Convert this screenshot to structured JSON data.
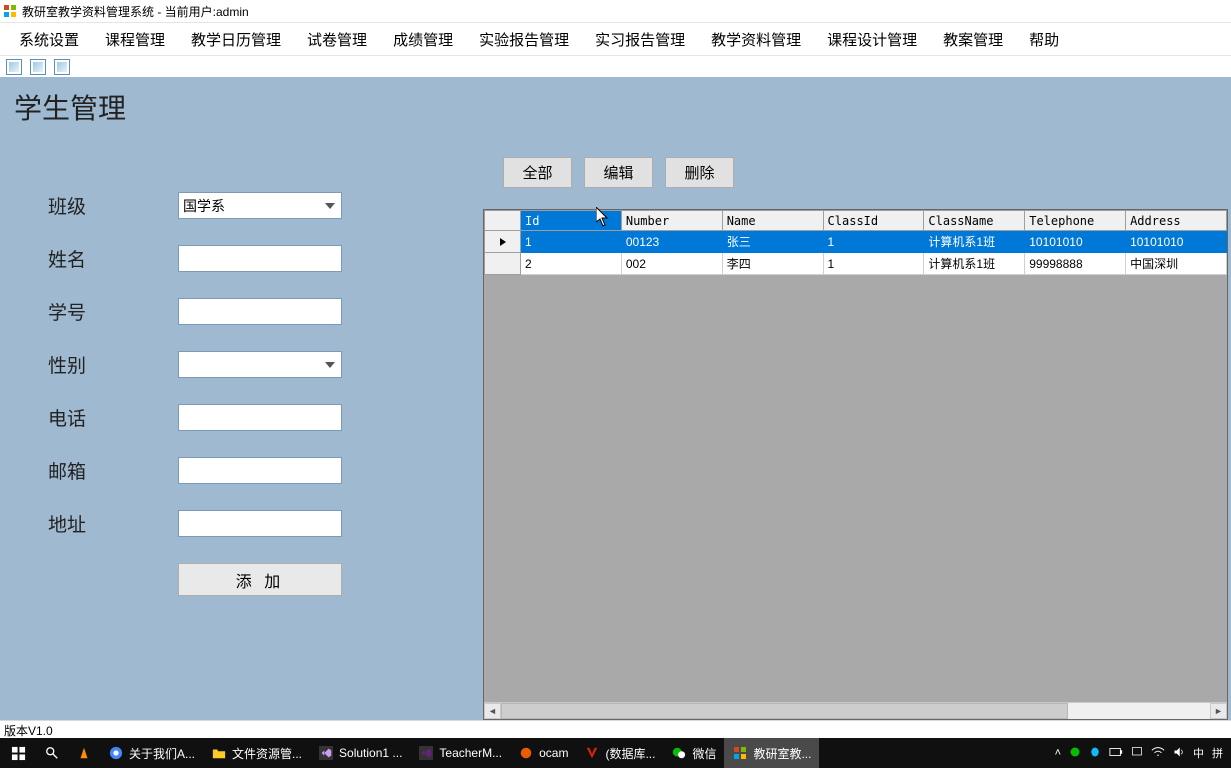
{
  "window": {
    "title": "教研室教学资料管理系统 - 当前用户:admin"
  },
  "menu": {
    "items": [
      "系统设置",
      "课程管理",
      "教学日历管理",
      "试卷管理",
      "成绩管理",
      "实验报告管理",
      "实习报告管理",
      "教学资料管理",
      "课程设计管理",
      "教案管理",
      "帮助"
    ]
  },
  "page_title": "学生管理",
  "form": {
    "labels": {
      "class": "班级",
      "name": "姓名",
      "sno": "学号",
      "gender": "性别",
      "phone": "电话",
      "email": "邮箱",
      "address": "地址"
    },
    "class_value": "国学系",
    "name_value": "",
    "sno_value": "",
    "gender_value": "",
    "phone_value": "",
    "email_value": "",
    "address_value": "",
    "add_button": "添 加"
  },
  "toolbar": {
    "all": "全部",
    "edit": "编辑",
    "delete": "删除"
  },
  "grid": {
    "headers": [
      "Id",
      "Number",
      "Name",
      "ClassId",
      "ClassName",
      "Telephone",
      "Address"
    ],
    "rows": [
      {
        "Id": "1",
        "Number": "00123",
        "Name": "张三",
        "ClassId": "1",
        "ClassName": "计算机系1班",
        "Telephone": "10101010",
        "Address": "10101010"
      },
      {
        "Id": "2",
        "Number": "002",
        "Name": "李四",
        "ClassId": "1",
        "ClassName": "计算机系1班",
        "Telephone": "99998888",
        "Address": "中国深圳"
      }
    ],
    "selected_row": 0,
    "selected_col": 0
  },
  "status": {
    "version": "版本V1.0"
  },
  "taskbar": {
    "items": [
      {
        "label": "",
        "icon": "search",
        "color": "#fff"
      },
      {
        "label": "",
        "icon": "vlc",
        "color": "#ff8c00"
      },
      {
        "label": "关于我们A...",
        "icon": "chrome"
      },
      {
        "label": "文件资源管...",
        "icon": "explorer"
      },
      {
        "label": "Solution1 ...",
        "icon": "vs"
      },
      {
        "label": "TeacherM...",
        "icon": "vs2"
      },
      {
        "label": "ocam",
        "icon": "ocam"
      },
      {
        "label": "(数据库...",
        "icon": "virtual"
      },
      {
        "label": "微信",
        "icon": "wechat"
      },
      {
        "label": "教研室教...",
        "icon": "app",
        "active": true
      }
    ],
    "tray": [
      "中",
      "拼"
    ]
  }
}
